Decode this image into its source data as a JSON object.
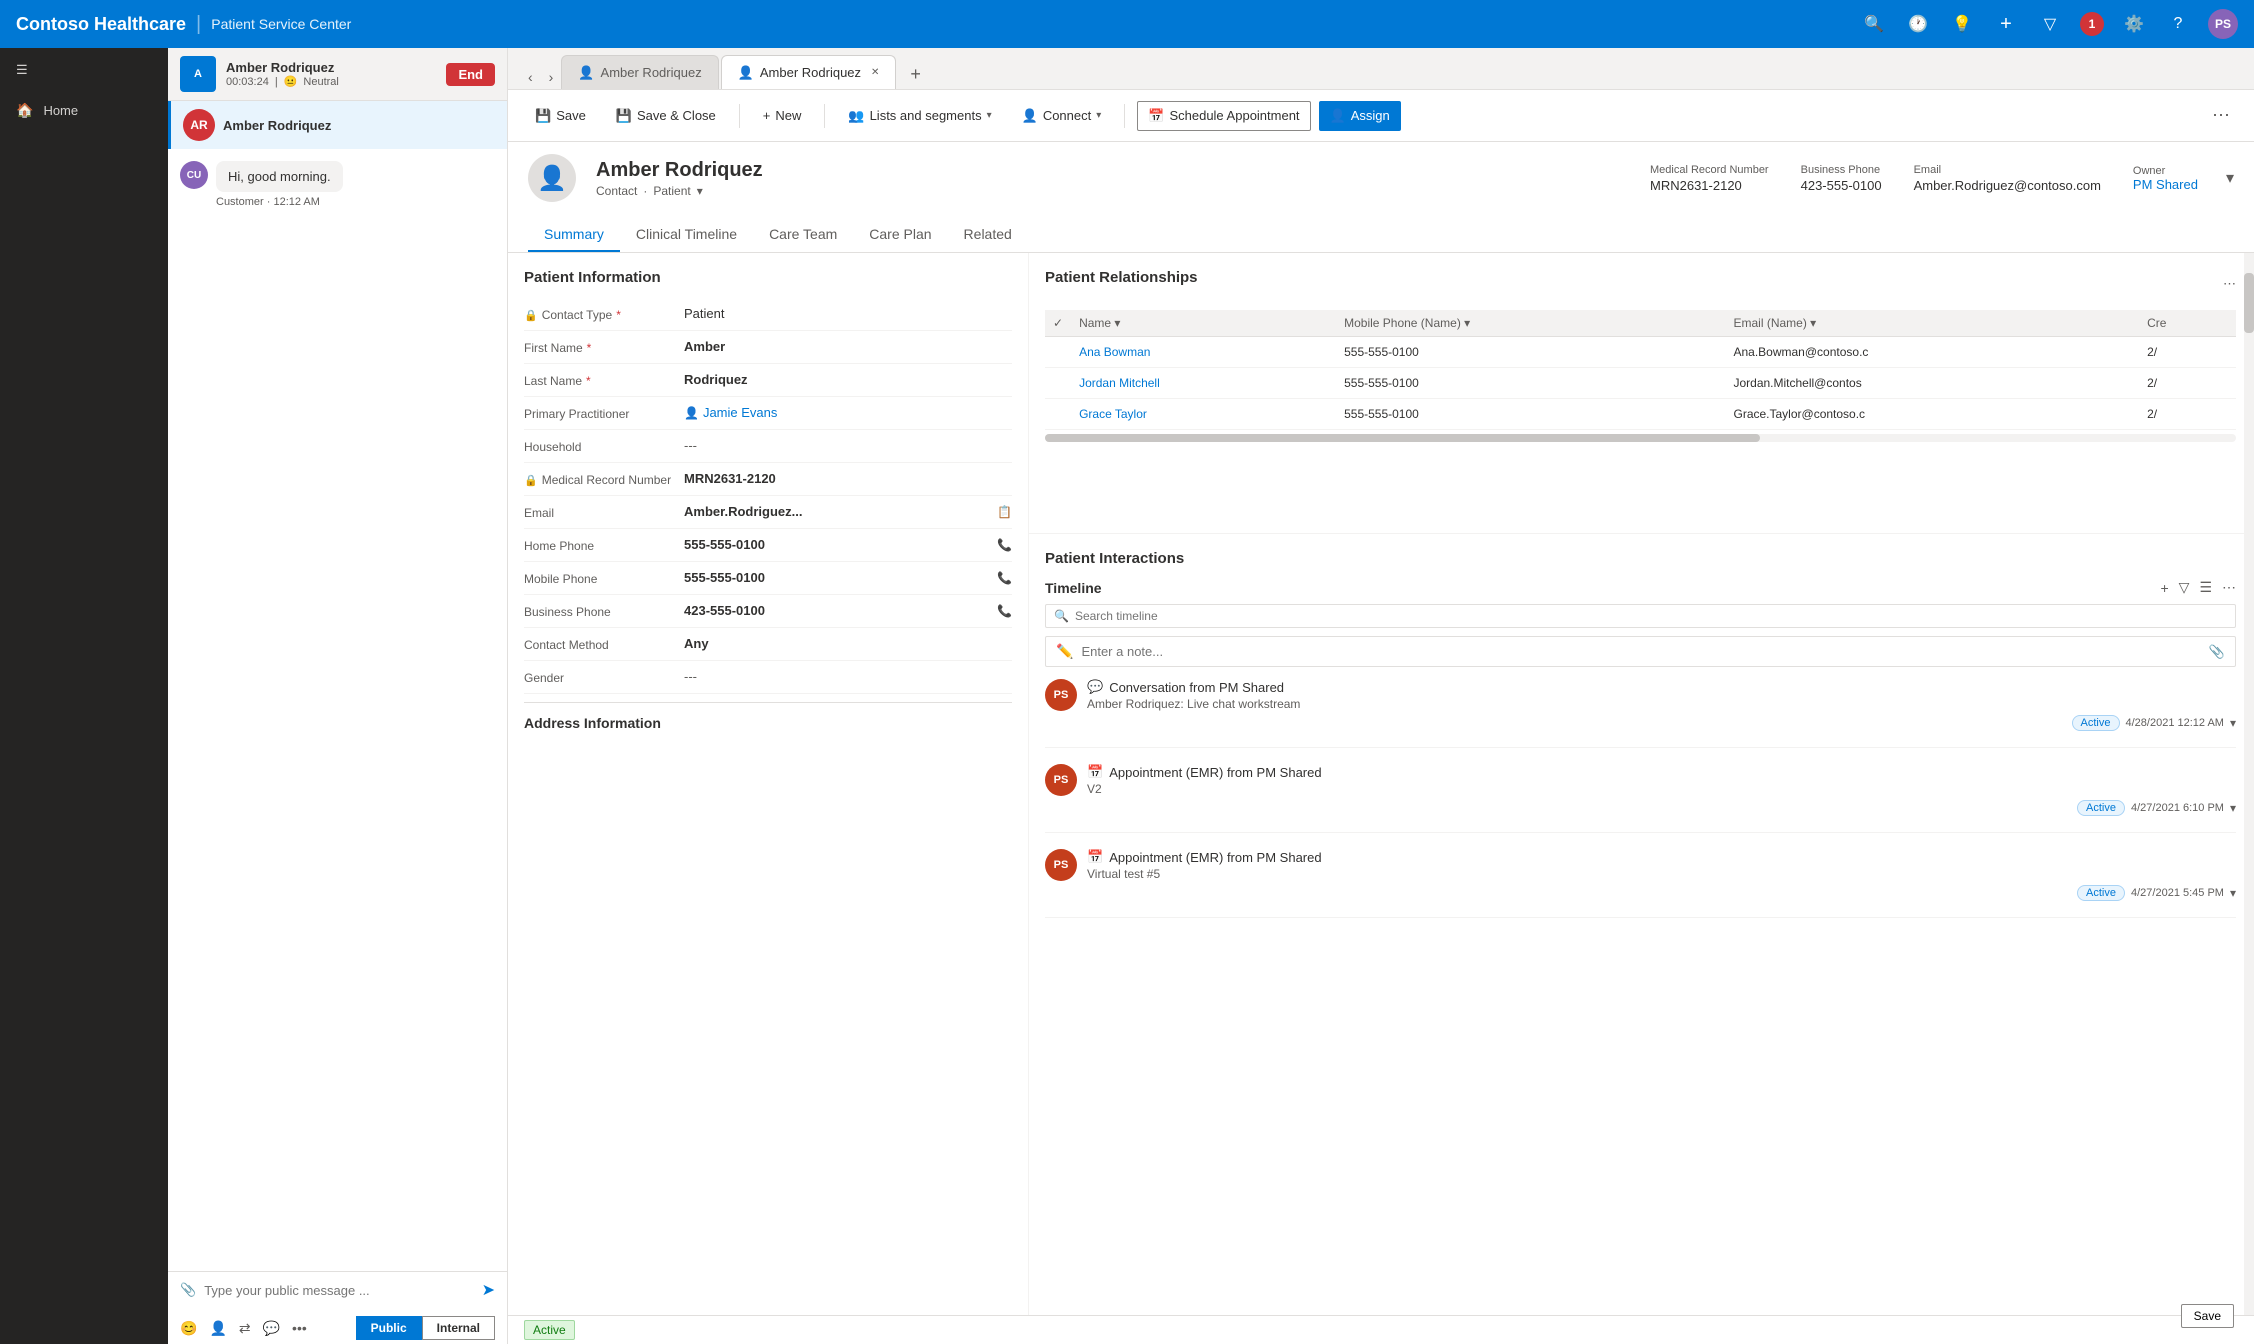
{
  "app": {
    "brand": "Contoso Healthcare",
    "module": "Patient Service Center"
  },
  "topnav": {
    "icons": [
      "search",
      "recent",
      "lightbulb",
      "plus",
      "funnel",
      "settings",
      "help"
    ],
    "notification_count": "1",
    "user_initials": "PS"
  },
  "sidebar": {
    "items": [
      {
        "label": "Home",
        "icon": "🏠"
      }
    ]
  },
  "active_call": {
    "caller": "Amber Rodriquez",
    "duration": "00:03:24",
    "sentiment": "Neutral",
    "end_label": "End"
  },
  "chat_contact": {
    "name": "Amber Rodriquez",
    "avatar": "AR"
  },
  "chat": {
    "messages": [
      {
        "avatar": "CU",
        "text": "Hi, good morning.",
        "meta": "Customer · 12:12 AM"
      }
    ],
    "input_placeholder": "Type your public message ...",
    "visibility_options": [
      "Public",
      "Internal"
    ],
    "active_visibility": "Public"
  },
  "browser_tabs": [
    {
      "label": "Amber Rodriquez",
      "active": false,
      "icon": "👤"
    },
    {
      "label": "Amber Rodriquez",
      "active": true,
      "icon": "👤",
      "closeable": true
    }
  ],
  "toolbar": {
    "save_label": "Save",
    "save_close_label": "Save & Close",
    "new_label": "New",
    "lists_label": "Lists and segments",
    "connect_label": "Connect",
    "schedule_label": "Schedule Appointment",
    "assign_label": "Assign"
  },
  "patient": {
    "name": "Amber Rodriquez",
    "type": "Contact",
    "sub_type": "Patient",
    "avatar_text": "👤",
    "mrn": "MRN2631-2120",
    "mrn_label": "Medical Record Number",
    "business_phone": "423-555-0100",
    "business_phone_label": "Business Phone",
    "email": "Amber.Rodriguez@contoso.com",
    "email_label": "Email",
    "owner": "PM Shared",
    "owner_label": "Owner"
  },
  "record_tabs": [
    {
      "label": "Summary",
      "active": true
    },
    {
      "label": "Clinical Timeline",
      "active": false
    },
    {
      "label": "Care Team",
      "active": false
    },
    {
      "label": "Care Plan",
      "active": false
    },
    {
      "label": "Related",
      "active": false
    }
  ],
  "patient_info": {
    "section_title": "Patient Information",
    "fields": [
      {
        "label": "Contact Type",
        "value": "Patient",
        "required": true,
        "locked": true
      },
      {
        "label": "First Name",
        "value": "Amber",
        "required": true,
        "locked": false
      },
      {
        "label": "Last Name",
        "value": "Rodriquez",
        "required": true,
        "locked": false
      },
      {
        "label": "Primary Practitioner",
        "value": "Jamie Evans",
        "required": false,
        "locked": false,
        "is_link": true
      },
      {
        "label": "Household",
        "value": "---",
        "required": false,
        "locked": false
      },
      {
        "label": "Medical Record Number",
        "value": "MRN2631-2120",
        "required": false,
        "locked": true
      },
      {
        "label": "Email",
        "value": "Amber.Rodriguez...",
        "required": false,
        "locked": false,
        "has_copy": true
      },
      {
        "label": "Home Phone",
        "value": "555-555-0100",
        "required": false,
        "locked": false,
        "has_phone": true
      },
      {
        "label": "Mobile Phone",
        "value": "555-555-0100",
        "required": false,
        "locked": false,
        "has_phone": true
      },
      {
        "label": "Business Phone",
        "value": "423-555-0100",
        "required": false,
        "locked": false,
        "has_phone": true
      },
      {
        "label": "Contact Method",
        "value": "Any",
        "required": false,
        "locked": false
      },
      {
        "label": "Gender",
        "value": "---",
        "required": false,
        "locked": false
      }
    ]
  },
  "address_info": {
    "section_title": "Address Information"
  },
  "relationships": {
    "section_title": "Patient Relationships",
    "columns": [
      "Name",
      "Mobile Phone (Name)",
      "Email (Name)",
      "Cre"
    ],
    "rows": [
      {
        "name": "Ana Bowman",
        "mobile": "555-555-0100",
        "email": "Ana.Bowman@contoso.c",
        "created": "2/"
      },
      {
        "name": "Jordan Mitchell",
        "mobile": "555-555-0100",
        "email": "Jordan.Mitchell@contos",
        "created": "2/"
      },
      {
        "name": "Grace Taylor",
        "mobile": "555-555-0100",
        "email": "Grace.Taylor@contoso.c",
        "created": "2/"
      }
    ]
  },
  "interactions": {
    "section_title": "Patient Interactions",
    "timeline_label": "Timeline",
    "search_placeholder": "Search timeline",
    "note_placeholder": "Enter a note...",
    "items": [
      {
        "avatar": "PS",
        "title": "Conversation from PM Shared",
        "subtitle": "Amber Rodriquez: Live chat workstream",
        "status": "Active",
        "date": "4/28/2021 12:12 AM",
        "type": "chat"
      },
      {
        "avatar": "PS",
        "title": "Appointment (EMR) from PM Shared",
        "subtitle": "V2",
        "status": "Active",
        "date": "4/27/2021 6:10 PM",
        "type": "calendar"
      },
      {
        "avatar": "PS",
        "title": "Appointment (EMR) from PM Shared",
        "subtitle": "Virtual test #5",
        "status": "Active",
        "date": "4/27/2021 5:45 PM",
        "type": "calendar"
      }
    ]
  },
  "bottom_bar": {
    "status": "Active",
    "save_label": "Save"
  }
}
